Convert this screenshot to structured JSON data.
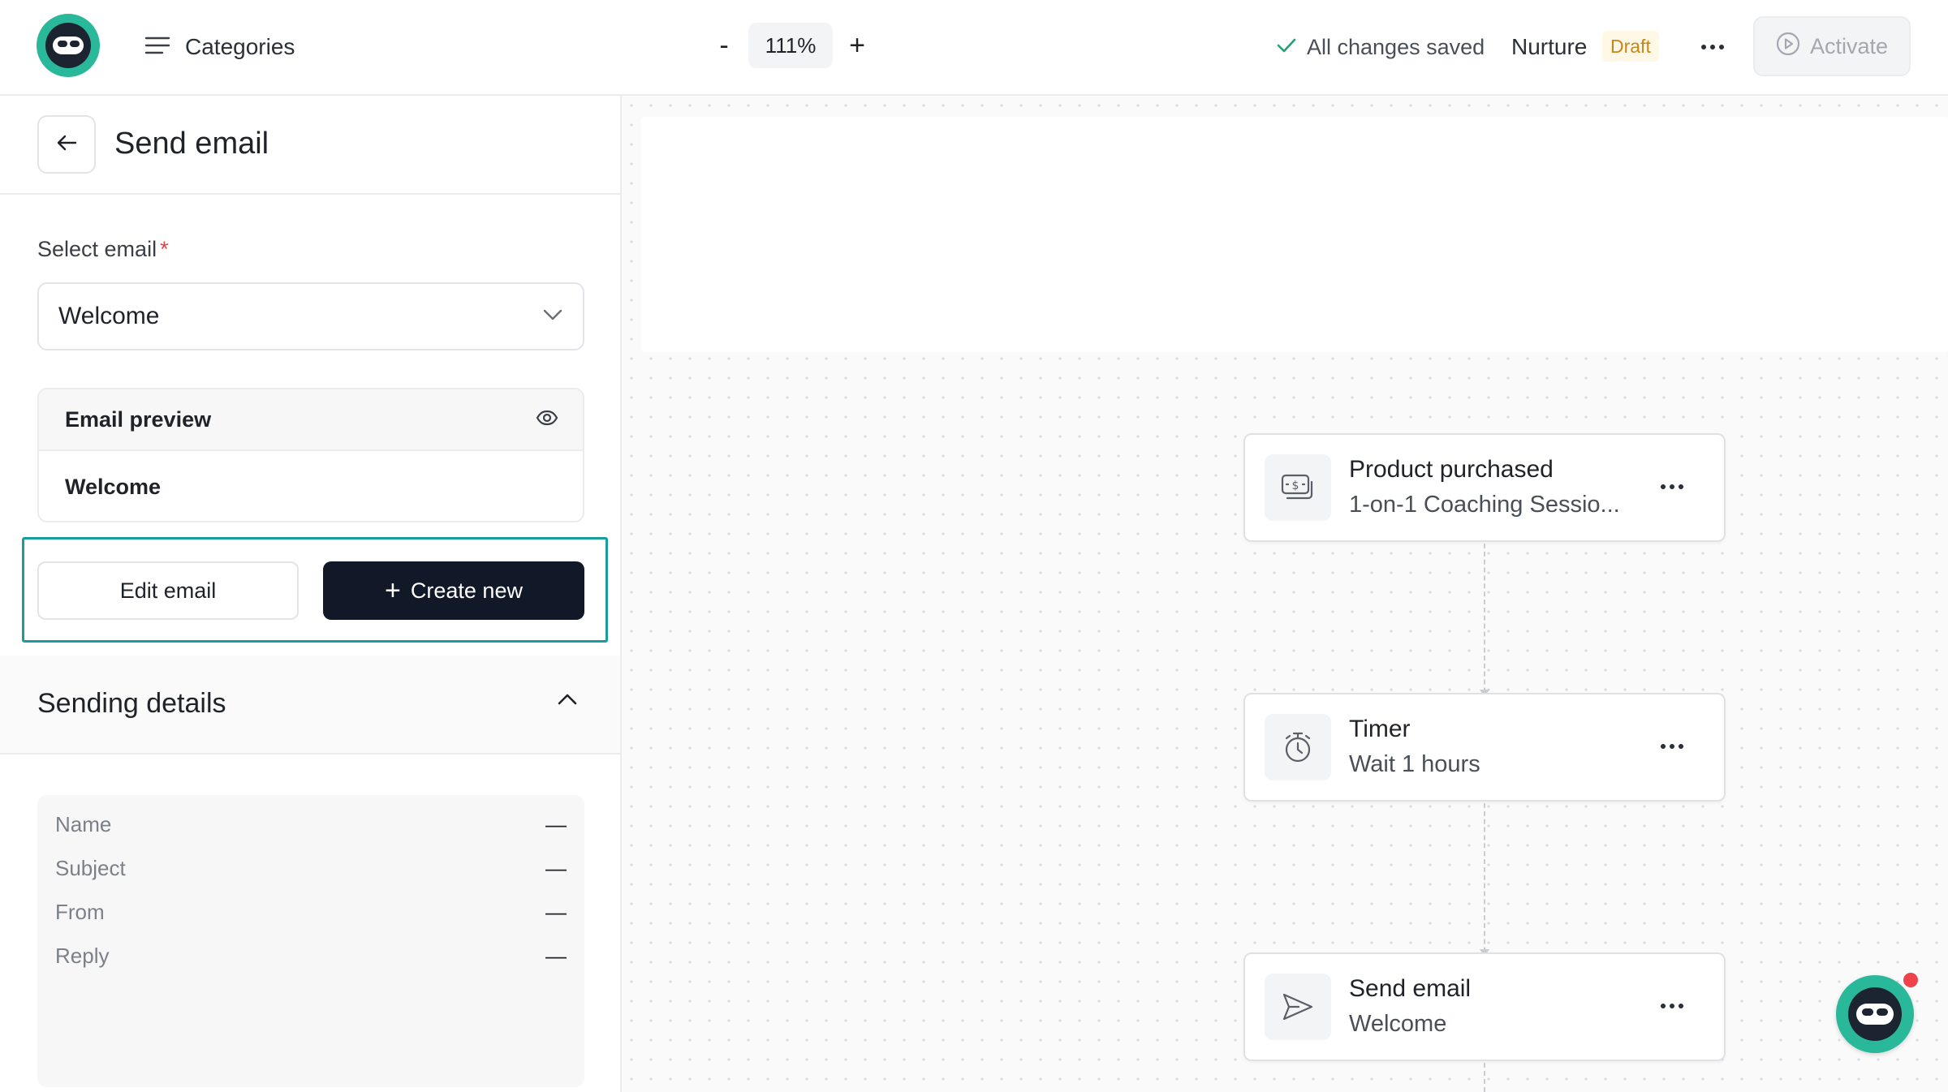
{
  "header": {
    "categories_label": "Categories",
    "zoom": {
      "minus": "-",
      "value": "111%",
      "plus": "+"
    },
    "save_status": "All changes saved",
    "workflow_name": "Nurture",
    "workflow_status": "Draft",
    "activate_label": "Activate"
  },
  "panel": {
    "title": "Send email",
    "select_label": "Select email",
    "required_mark": "*",
    "selected_email": "Welcome",
    "preview": {
      "title": "Email preview",
      "body": "Welcome"
    },
    "edit_label": "Edit email",
    "create_label": "Create new",
    "create_icon": "+",
    "sending_details": {
      "title": "Sending details",
      "rows": [
        {
          "key": "Name",
          "value": "—"
        },
        {
          "key": "Subject",
          "value": "—"
        },
        {
          "key": "From",
          "value": "—"
        },
        {
          "key": "Reply",
          "value": "—"
        }
      ]
    }
  },
  "canvas": {
    "nodes": [
      {
        "title": "Product purchased",
        "subtitle": "1-on-1 Coaching Sessio...",
        "icon": "money-icon"
      },
      {
        "title": "Timer",
        "subtitle": "Wait 1 hours",
        "icon": "stopwatch-icon"
      },
      {
        "title": "Send email",
        "subtitle": "Welcome",
        "icon": "send-icon"
      }
    ]
  },
  "colors": {
    "accent": "#2ab89a",
    "highlight": "#1a9d9a",
    "primary_button": "#111827",
    "draft_text": "#c6861a",
    "notification": "#f0424b"
  }
}
